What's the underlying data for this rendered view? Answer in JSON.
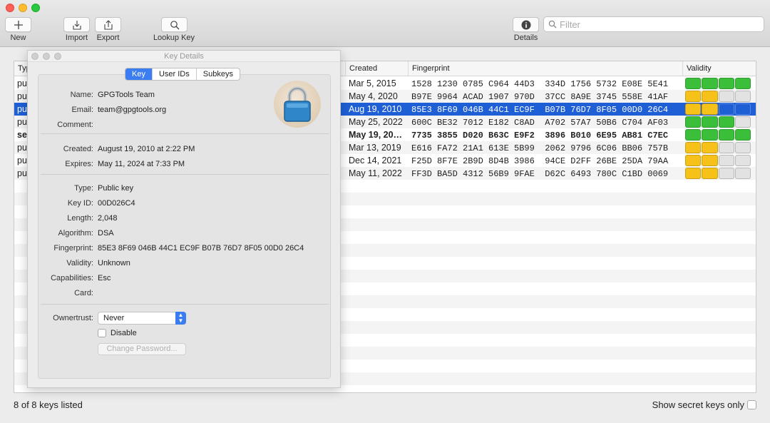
{
  "toolbar": {
    "new_label": "New",
    "import_label": "Import",
    "export_label": "Export",
    "lookup_label": "Lookup Key",
    "details_label": "Details",
    "filter_placeholder": "Filter"
  },
  "table": {
    "headers": {
      "type": "Type",
      "created": "Created",
      "fingerprint": "Fingerprint",
      "validity": "Validity"
    },
    "rows": [
      {
        "type": "pub",
        "created": "Mar 5, 2015",
        "fingerprint": "1528 1230 0785 C964 44D3  334D 1756 5732 E08E 5E41",
        "validity_level": 4,
        "validity_color": "green",
        "selected": false,
        "bold": false
      },
      {
        "type": "pub",
        "created": "May 4, 2020",
        "fingerprint": "B97E 9964 ACAD 1907 970D  37CC 8A9E 3745 558E 41AF",
        "validity_level": 2,
        "validity_color": "yellow",
        "selected": false,
        "bold": false
      },
      {
        "type": "pub",
        "created": "Aug 19, 2010",
        "fingerprint": "85E3 8F69 046B 44C1 EC9F  B07B 76D7 8F05 00D0 26C4",
        "validity_level": 2,
        "validity_color": "yellow",
        "selected": true,
        "bold": false
      },
      {
        "type": "pub",
        "created": "May 25, 2022",
        "fingerprint": "600C BE32 7012 E182 C8AD  A702 57A7 50B6 C704 AF03",
        "validity_level": 3,
        "validity_color": "green",
        "selected": false,
        "bold": false
      },
      {
        "type": "sec",
        "created": "May 19, 20…",
        "fingerprint": "7735 3855 D020 B63C E9F2  3896 B010 6E95 AB81 C7EC",
        "validity_level": 4,
        "validity_color": "green",
        "selected": false,
        "bold": true
      },
      {
        "type": "pub",
        "created": "Mar 13, 2019",
        "fingerprint": "E616 FA72 21A1 613E 5B99  2062 9796 6C06 BB06 757B",
        "validity_level": 2,
        "validity_color": "yellow",
        "selected": false,
        "bold": false
      },
      {
        "type": "pub",
        "created": "Dec 14, 2021",
        "fingerprint": "F25D 8F7E 2B9D 8D4B 3986  94CE D2FF 26BE 25DA 79AA",
        "validity_level": 2,
        "validity_color": "yellow",
        "selected": false,
        "bold": false
      },
      {
        "type": "pub",
        "created": "May 11, 2022",
        "fingerprint": "FF3D BA5D 4312 56B9 9FAE  D62C 6493 780C C1BD 0069",
        "validity_level": 2,
        "validity_color": "yellow",
        "selected": false,
        "bold": false
      }
    ]
  },
  "details": {
    "window_title": "Key Details",
    "tabs": [
      "Key",
      "User IDs",
      "Subkeys"
    ],
    "active_tab": "Key",
    "fields": {
      "name_label": "Name:",
      "name": "GPGTools Team",
      "email_label": "Email:",
      "email": "team@gpgtools.org",
      "comment_label": "Comment:",
      "comment": "",
      "created_label": "Created:",
      "created": "August 19, 2010 at 2:22 PM",
      "expires_label": "Expires:",
      "expires": "May 11, 2024 at 7:33 PM",
      "type_label": "Type:",
      "type": "Public key",
      "keyid_label": "Key ID:",
      "keyid": "00D026C4",
      "length_label": "Length:",
      "length": "2,048",
      "algorithm_label": "Algorithm:",
      "algorithm": "DSA",
      "fingerprint_label": "Fingerprint:",
      "fingerprint": "85E3 8F69 046B 44C1 EC9F  B07B 76D7 8F05 00D0 26C4",
      "validity_label": "Validity:",
      "validity": "Unknown",
      "capabilities_label": "Capabilities:",
      "capabilities": "Esc",
      "card_label": "Card:",
      "card": ""
    },
    "ownertrust_label": "Ownertrust:",
    "ownertrust_value": "Never",
    "disable_label": "Disable",
    "change_password_label": "Change Password..."
  },
  "footer": {
    "count_text": "8 of 8 keys listed",
    "secret_only_label": "Show secret keys only"
  },
  "colors": {
    "selection": "#1f5fd6",
    "validity_green": "#3bbf3b",
    "validity_yellow": "#f6c21a",
    "validity_empty": "#e2e2e2",
    "accent": "#3b7cf1"
  }
}
